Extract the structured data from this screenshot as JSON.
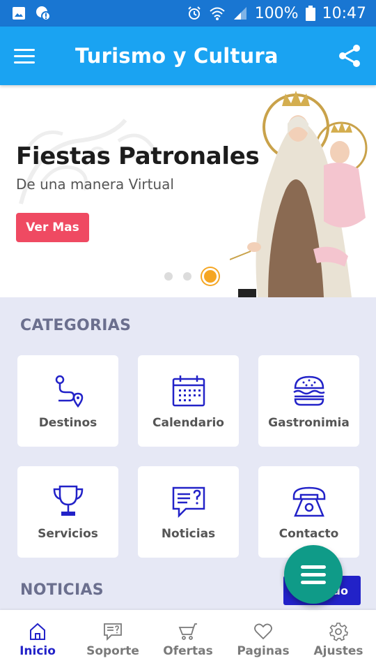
{
  "status_bar": {
    "battery": "100%",
    "time": "10:47",
    "icons": [
      "image-icon",
      "alert-icon",
      "alarm-icon",
      "wifi-icon",
      "signal-icon",
      "battery-icon"
    ]
  },
  "app_bar": {
    "title": "Turismo y Cultura",
    "menu_icon": "hamburger-icon",
    "share_icon": "share-icon"
  },
  "hero": {
    "title": "Fiestas Patronales",
    "subtitle": "De una manera Virtual",
    "button_label": "Ver Mas",
    "slides_total": 3,
    "active_slide": 3
  },
  "categories": {
    "title": "CATEGORIAS",
    "items": [
      {
        "label": "Destinos",
        "icon": "route-icon"
      },
      {
        "label": "Calendario",
        "icon": "calendar-icon"
      },
      {
        "label": "Gastronimia",
        "icon": "burger-icon"
      },
      {
        "label": "Servicios",
        "icon": "trophy-icon"
      },
      {
        "label": "Noticias",
        "icon": "chat-question-icon"
      },
      {
        "label": "Contacto",
        "icon": "telephone-icon"
      }
    ]
  },
  "news": {
    "title": "NOTICIAS",
    "button_label": "do"
  },
  "bottom_nav": {
    "items": [
      {
        "label": "Inicio",
        "icon": "home-icon",
        "active": true
      },
      {
        "label": "Soporte",
        "icon": "support-chat-icon"
      },
      {
        "label": "Ofertas",
        "icon": "cart-icon"
      },
      {
        "label": "Paginas",
        "icon": "heart-icon"
      },
      {
        "label": "Ajustes",
        "icon": "gear-icon"
      }
    ]
  },
  "colors": {
    "status_bar": "#1976d2",
    "app_bar": "#1aa3f2",
    "accent_button": "#ef4a62",
    "primary": "#2222c8",
    "fab": "#0f9b88",
    "background": "#e6e8f5",
    "dot_active": "#f5a623"
  }
}
